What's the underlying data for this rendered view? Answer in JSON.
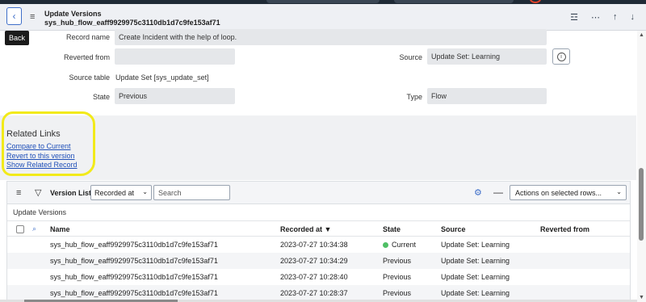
{
  "header": {
    "title_line1": "Update Versions",
    "title_line2": "sys_hub_flow_eaff9929975c3110db1d7c9fe153af71",
    "back_tooltip": "Back"
  },
  "form": {
    "record_name_label": "Record name",
    "record_name_value": "Create Incident with the help of loop.",
    "reverted_from_label": "Reverted from",
    "reverted_from_value": "",
    "source_label": "Source",
    "source_value": "Update Set: Learning",
    "source_table_label": "Source table",
    "source_table_value": "Update Set [sys_update_set]",
    "state_label": "State",
    "state_value": "Previous",
    "type_label": "Type",
    "type_value": "Flow"
  },
  "related_links": {
    "title": "Related Links",
    "links": [
      "Compare to Current",
      "Revert to this version",
      "Show Related Record"
    ]
  },
  "list": {
    "title": "Version List",
    "filter_field": "Recorded at",
    "search_placeholder": "Search",
    "actions_label": "Actions on selected rows...",
    "breadcrumb": "Update Versions",
    "columns": [
      "Name",
      "Recorded at ▼",
      "State",
      "Source",
      "Reverted from"
    ],
    "rows": [
      {
        "name": "sys_hub_flow_eaff9929975c3110db1d7c9fe153af71",
        "recorded_at": "2023-07-27 10:34:38",
        "state": "Current",
        "source": "Update Set: Learning",
        "reverted_from": ""
      },
      {
        "name": "sys_hub_flow_eaff9929975c3110db1d7c9fe153af71",
        "recorded_at": "2023-07-27 10:34:29",
        "state": "Previous",
        "source": "Update Set: Learning",
        "reverted_from": ""
      },
      {
        "name": "sys_hub_flow_eaff9929975c3110db1d7c9fe153af71",
        "recorded_at": "2023-07-27 10:28:40",
        "state": "Previous",
        "source": "Update Set: Learning",
        "reverted_from": ""
      },
      {
        "name": "sys_hub_flow_eaff9929975c3110db1d7c9fe153af71",
        "recorded_at": "2023-07-27 10:28:37",
        "state": "Previous",
        "source": "Update Set: Learning",
        "reverted_from": ""
      }
    ]
  },
  "icons": {
    "back": "chevron-left-icon",
    "menu": "hamburger-icon",
    "settings": "sliders-icon",
    "more": "ellipsis-icon",
    "prev": "arrow-up-icon",
    "next": "arrow-down-icon",
    "info": "info-icon",
    "filter": "filter-icon",
    "gear": "gear-icon",
    "search": "search-icon"
  },
  "colors": {
    "link": "#1f4fb8",
    "accent": "#3f6fc9",
    "current_dot": "#4fbf65",
    "highlight": "#f2ea1a"
  }
}
